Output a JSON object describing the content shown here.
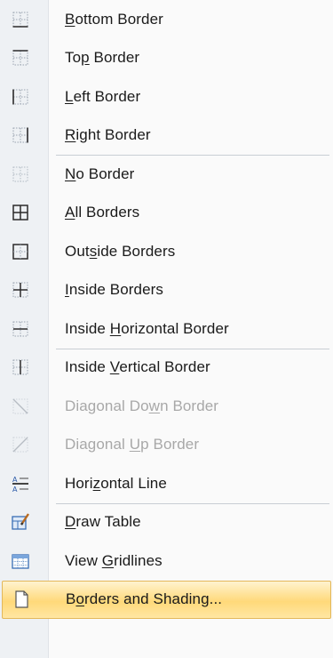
{
  "menu": {
    "items": [
      {
        "name": "bottom-border",
        "icon": "bottom-border-icon",
        "pre": "",
        "key": "B",
        "post": "ottom Border",
        "disabled": false
      },
      {
        "name": "top-border",
        "icon": "top-border-icon",
        "pre": "To",
        "key": "p",
        "post": " Border",
        "disabled": false
      },
      {
        "name": "left-border",
        "icon": "left-border-icon",
        "pre": "",
        "key": "L",
        "post": "eft Border",
        "disabled": false
      },
      {
        "name": "right-border",
        "icon": "right-border-icon",
        "pre": "",
        "key": "R",
        "post": "ight Border",
        "disabled": false
      },
      {
        "name": "no-border",
        "icon": "no-border-icon",
        "pre": "",
        "key": "N",
        "post": "o Border",
        "disabled": false
      },
      {
        "name": "all-borders",
        "icon": "all-borders-icon",
        "pre": "",
        "key": "A",
        "post": "ll Borders",
        "disabled": false
      },
      {
        "name": "outside-borders",
        "icon": "outside-borders-icon",
        "pre": "Out",
        "key": "s",
        "post": "ide Borders",
        "disabled": false
      },
      {
        "name": "inside-borders",
        "icon": "inside-borders-icon",
        "pre": "",
        "key": "I",
        "post": "nside Borders",
        "disabled": false
      },
      {
        "name": "inside-horizontal-border",
        "icon": "inside-horizontal-border-icon",
        "pre": "Inside ",
        "key": "H",
        "post": "orizontal Border",
        "disabled": false
      },
      {
        "name": "inside-vertical-border",
        "icon": "inside-vertical-border-icon",
        "pre": "Inside ",
        "key": "V",
        "post": "ertical Border",
        "disabled": false
      },
      {
        "name": "diagonal-down-border",
        "icon": "diagonal-down-border-icon",
        "pre": "Diagonal Do",
        "key": "w",
        "post": "n Border",
        "disabled": true
      },
      {
        "name": "diagonal-up-border",
        "icon": "diagonal-up-border-icon",
        "pre": "Diagonal ",
        "key": "U",
        "post": "p Border",
        "disabled": true
      },
      {
        "name": "horizontal-line",
        "icon": "horizontal-line-icon",
        "pre": "Hori",
        "key": "z",
        "post": "ontal Line",
        "disabled": false
      },
      {
        "name": "draw-table",
        "icon": "draw-table-icon",
        "pre": "",
        "key": "D",
        "post": "raw Table",
        "disabled": false
      },
      {
        "name": "view-gridlines",
        "icon": "view-gridlines-icon",
        "pre": "View ",
        "key": "G",
        "post": "ridlines",
        "disabled": false
      },
      {
        "name": "borders-and-shading",
        "icon": "borders-and-shading-icon",
        "pre": "B",
        "key": "o",
        "post": "rders and Shading...",
        "disabled": false,
        "highlighted": true
      }
    ]
  }
}
